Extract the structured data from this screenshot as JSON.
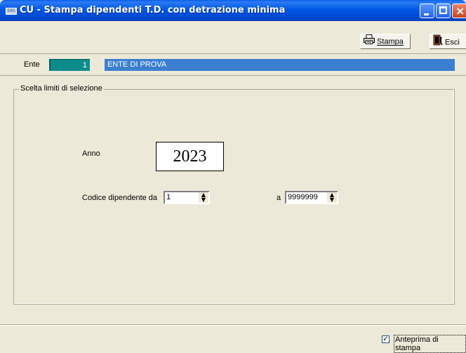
{
  "window": {
    "title": "CU - Stampa dipendenti T.D. con detrazione minima",
    "icon_text": "EBS"
  },
  "toolbar": {
    "stampa_label": "Stampa",
    "esci_label": "Esci"
  },
  "ente": {
    "label": "Ente",
    "code": "1",
    "name": "ENTE DI PROVA"
  },
  "selection": {
    "legend": "Scelta limiti di selezione",
    "anno_label": "Anno",
    "anno_value": "2023",
    "codice_label": "Codice dipendente da",
    "codice_da": "1",
    "a_label": "a",
    "codice_a": "9999999"
  },
  "footer": {
    "anteprima_label": "Anteprima di stampa",
    "anteprima_checked": true
  },
  "colors": {
    "titlebar": "#0058e6",
    "ente_code_bg": "#0e8c8c",
    "ente_name_bg": "#3c7fd0",
    "window_bg": "#ece9d8"
  }
}
